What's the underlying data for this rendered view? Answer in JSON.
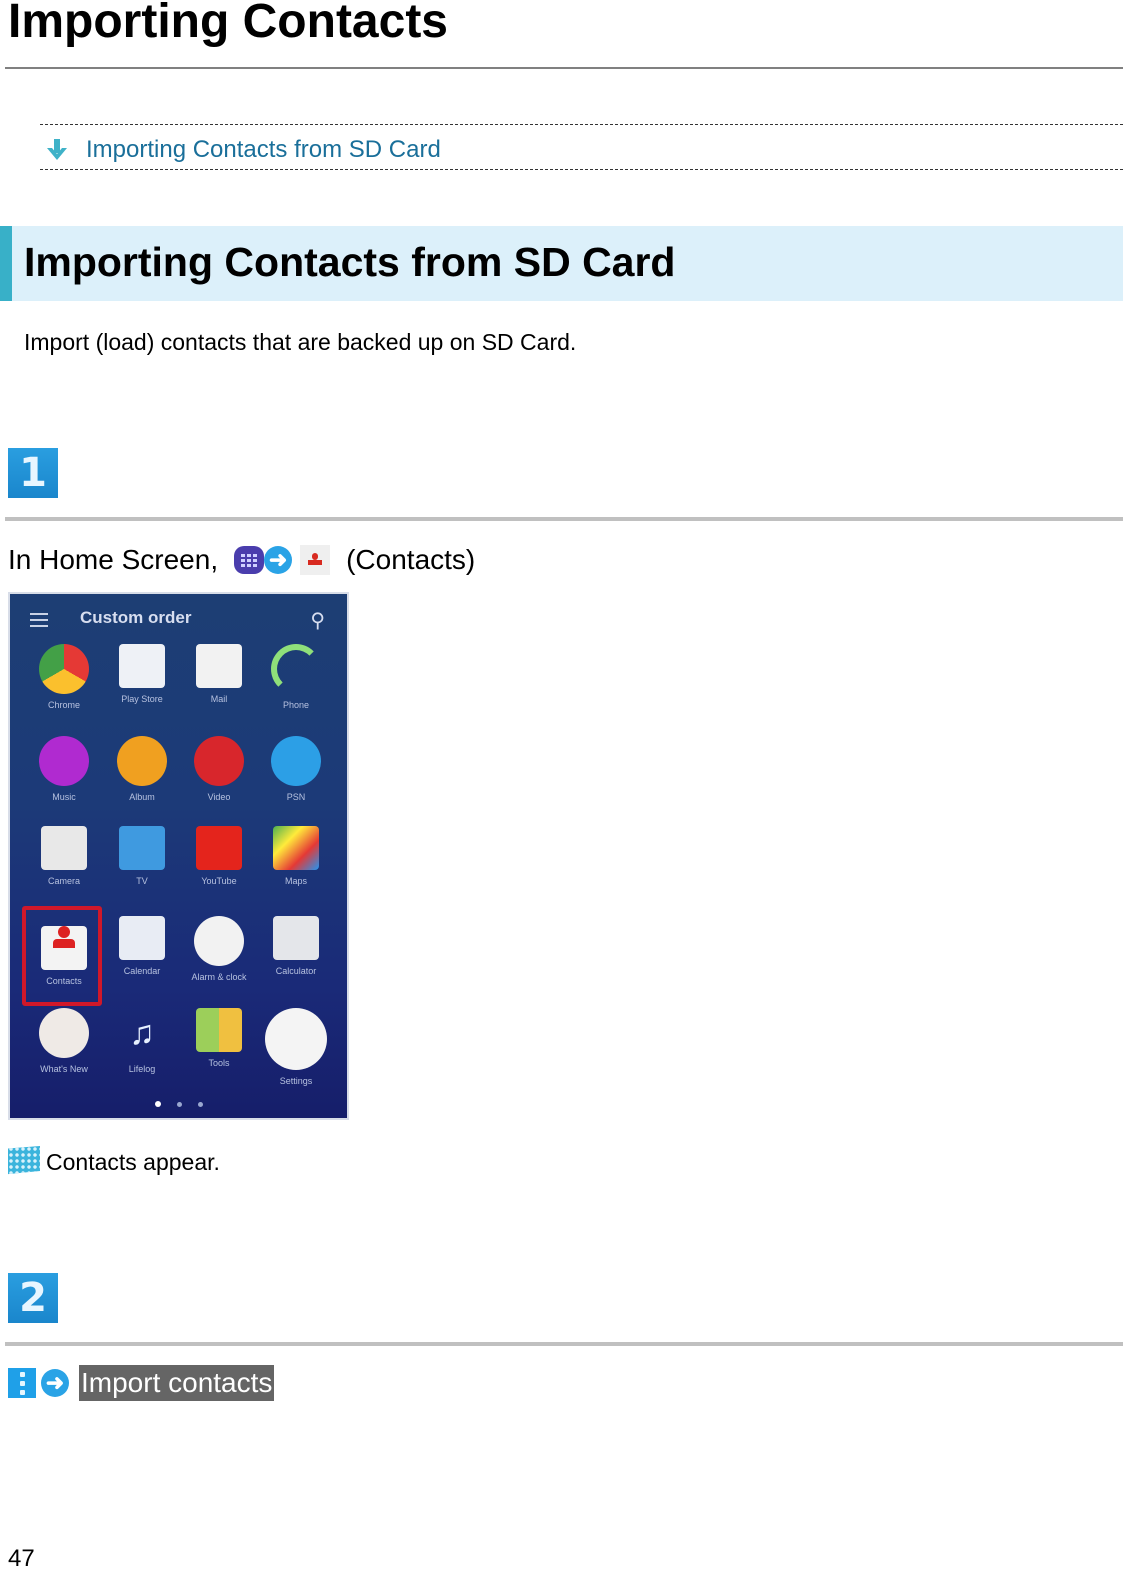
{
  "page": {
    "title": "Importing Contacts",
    "page_number": "47"
  },
  "toc": {
    "links": [
      {
        "label": "Importing Contacts from SD Card",
        "icon": "arrow-down-icon"
      }
    ]
  },
  "section": {
    "title": "Importing Contacts from SD Card",
    "intro": "Import (load) contacts that are backed up on SD Card.",
    "accent_color": "#38b0c8",
    "header_bg": "#dcf0fa"
  },
  "steps": [
    {
      "number": "1",
      "prefix": "In Home Screen,",
      "icons": [
        "apps-icon",
        "next-arrow-icon",
        "contacts-icon"
      ],
      "suffix": "(Contacts)",
      "result": "Contacts appear.",
      "screenshot": {
        "header_title": "Custom order",
        "apps": [
          {
            "label": "Chrome",
            "icon": "chrome-icon"
          },
          {
            "label": "Play Store",
            "icon": "play-store-icon"
          },
          {
            "label": "Mail",
            "icon": "mail-icon"
          },
          {
            "label": "Phone",
            "icon": "phone-icon"
          },
          {
            "label": "Music",
            "icon": "music-icon"
          },
          {
            "label": "Album",
            "icon": "album-icon"
          },
          {
            "label": "Video",
            "icon": "video-icon"
          },
          {
            "label": "PSN",
            "icon": "playstation-icon"
          },
          {
            "label": "Camera",
            "icon": "camera-icon"
          },
          {
            "label": "TV",
            "icon": "tv-icon"
          },
          {
            "label": "YouTube",
            "icon": "youtube-icon"
          },
          {
            "label": "Maps",
            "icon": "maps-icon"
          },
          {
            "label": "Contacts",
            "icon": "contacts-icon",
            "highlighted": true
          },
          {
            "label": "Calendar",
            "icon": "calendar-icon"
          },
          {
            "label": "Alarm & clock",
            "icon": "clock-icon"
          },
          {
            "label": "Calculator",
            "icon": "calculator-icon"
          },
          {
            "label": "What's New",
            "icon": "whats-new-icon"
          },
          {
            "label": "Lifelog",
            "icon": "lifelog-icon"
          },
          {
            "label": "Tools",
            "icon": "tools-folder-icon"
          },
          {
            "label": "Settings",
            "icon": "settings-icon"
          }
        ],
        "page_indicator": {
          "pages": 3,
          "current": 1
        }
      }
    },
    {
      "number": "2",
      "icons": [
        "menu-icon",
        "next-arrow-icon"
      ],
      "button_label": "Import contacts"
    }
  ]
}
